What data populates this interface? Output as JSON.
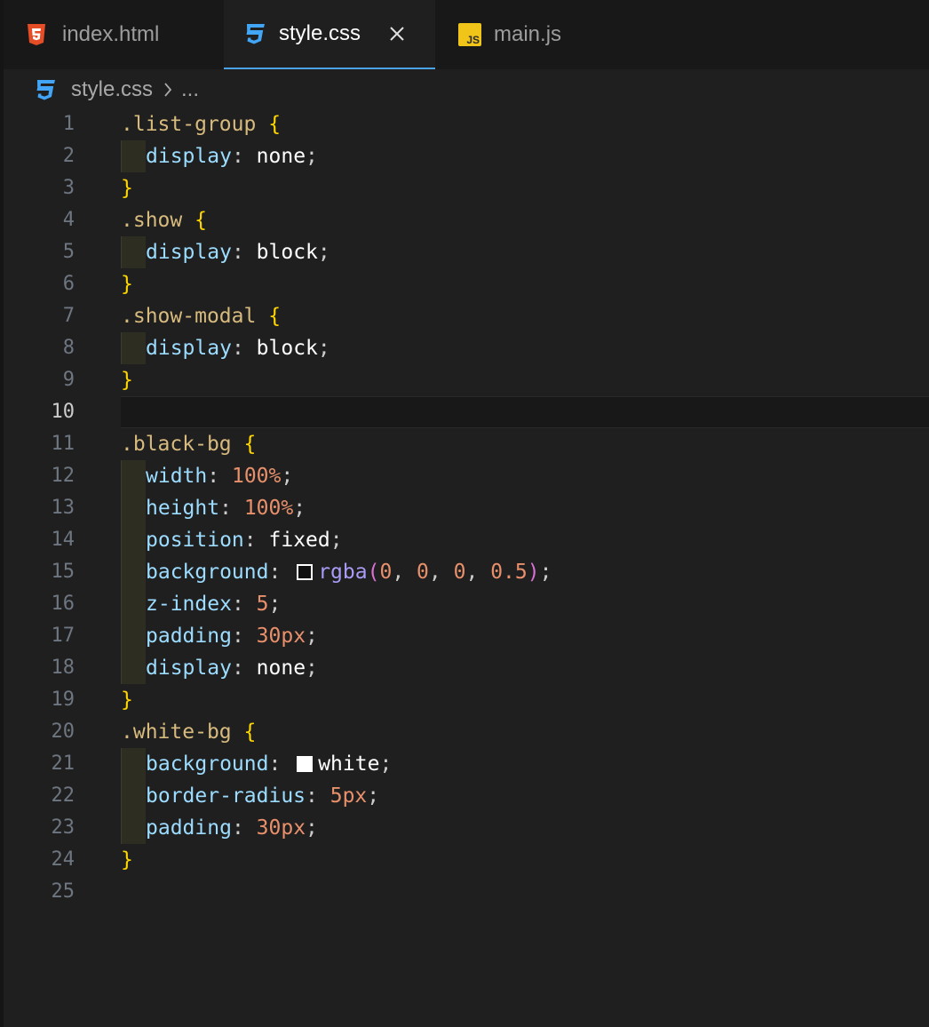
{
  "tabs": [
    {
      "label": "index.html",
      "icon": "html5-icon",
      "active": false
    },
    {
      "label": "style.css",
      "icon": "css3-icon",
      "active": true
    },
    {
      "label": "main.js",
      "icon": "javascript-icon",
      "active": false
    }
  ],
  "tab_close_icon": "close-icon",
  "breadcrumb": {
    "file": "style.css",
    "separator_icon": "chevron-right-icon",
    "ellipsis": "..."
  },
  "editor": {
    "current_line": 10,
    "lines": [
      {
        "n": "1",
        "text": ".list-group {"
      },
      {
        "n": "2",
        "text": "display: none;"
      },
      {
        "n": "3",
        "text": "}"
      },
      {
        "n": "4",
        "text": ".show {"
      },
      {
        "n": "5",
        "text": "display: block;"
      },
      {
        "n": "6",
        "text": "}"
      },
      {
        "n": "7",
        "text": ".show-modal {"
      },
      {
        "n": "8",
        "text": "display: block;"
      },
      {
        "n": "9",
        "text": "}"
      },
      {
        "n": "10",
        "text": ""
      },
      {
        "n": "11",
        "text": ".black-bg {"
      },
      {
        "n": "12",
        "text": "width: 100%;"
      },
      {
        "n": "13",
        "text": "height: 100%;"
      },
      {
        "n": "14",
        "text": "position: fixed;"
      },
      {
        "n": "15",
        "text": "background: rgba(0, 0, 0, 0.5);"
      },
      {
        "n": "16",
        "text": "z-index: 5;"
      },
      {
        "n": "17",
        "text": "padding: 30px;"
      },
      {
        "n": "18",
        "text": "display: none;"
      },
      {
        "n": "19",
        "text": "}"
      },
      {
        "n": "20",
        "text": ".white-bg {"
      },
      {
        "n": "21",
        "text": "background: white;"
      },
      {
        "n": "22",
        "text": "border-radius: 5px;"
      },
      {
        "n": "23",
        "text": "padding: 30px;"
      },
      {
        "n": "24",
        "text": "}"
      },
      {
        "n": "25",
        "text": ""
      }
    ]
  },
  "colors": {
    "background": "#1f1f1f",
    "tabbar": "#181818",
    "active_tab_border": "#4aa3e6",
    "selector": "#d7ba7d",
    "brace": "#ffd700",
    "property": "#9cdcfe",
    "number": "#e8906c",
    "function": "#a89cf7"
  }
}
